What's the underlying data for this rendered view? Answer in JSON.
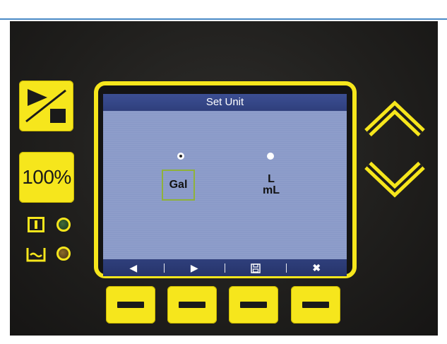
{
  "screen": {
    "title": "Set Unit",
    "options": [
      {
        "label": "Gal",
        "selected": true
      },
      {
        "label_line1": "L",
        "label_line2": "mL",
        "selected": false
      }
    ],
    "softkeys": [
      {
        "icon": "left-arrow-icon",
        "glyph": "◀"
      },
      {
        "icon": "right-arrow-icon",
        "glyph": "▶"
      },
      {
        "icon": "save-icon",
        "glyph": "🖫"
      },
      {
        "icon": "close-icon",
        "glyph": "✖"
      }
    ]
  },
  "panel": {
    "pct_button_label": "100%",
    "accent_color": "#f6e61c"
  }
}
